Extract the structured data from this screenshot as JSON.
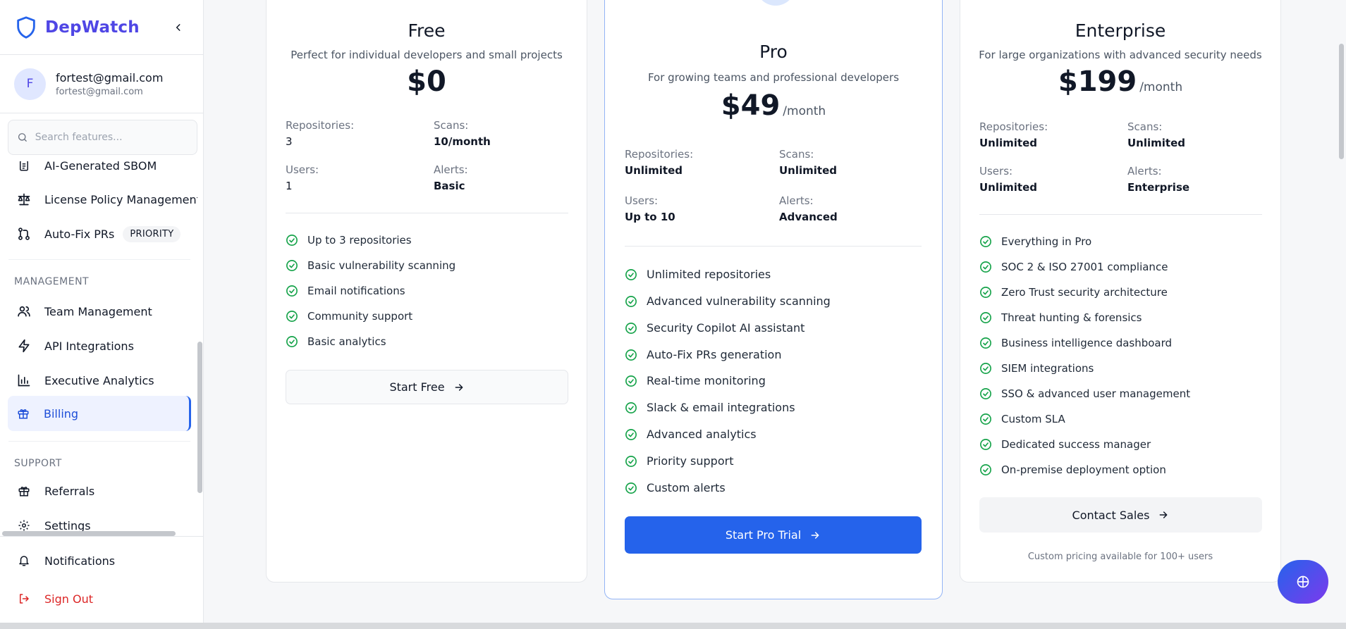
{
  "app": {
    "name": "DepWatch"
  },
  "user": {
    "initial": "F",
    "name": "fortest@gmail.com",
    "email": "fortest@gmail.com"
  },
  "search": {
    "placeholder": "Search features..."
  },
  "nav": {
    "partial_item": "AI-Generated SBOM",
    "items_top": [
      {
        "label": "License Policy Management",
        "icon": "scale-icon"
      },
      {
        "label": "Auto-Fix PRs",
        "icon": "git-pull-request-icon",
        "badge": "PRIORITY"
      }
    ],
    "management_label": "MANAGEMENT",
    "management": [
      {
        "label": "Team Management",
        "icon": "users-icon"
      },
      {
        "label": "API Integrations",
        "icon": "zap-icon"
      },
      {
        "label": "Executive Analytics",
        "icon": "bar-chart-icon"
      },
      {
        "label": "Billing",
        "icon": "gift-icon",
        "active": true
      }
    ],
    "support_label": "SUPPORT",
    "support": [
      {
        "label": "Referrals",
        "icon": "gift-icon"
      },
      {
        "label": "Settings",
        "icon": "gear-icon"
      }
    ],
    "bottom": [
      {
        "label": "Notifications",
        "icon": "bell-icon"
      },
      {
        "label": "Sign Out",
        "icon": "log-out-icon"
      }
    ]
  },
  "plans": {
    "free": {
      "name": "Free",
      "desc": "Perfect for individual developers and small projects",
      "price": "$0",
      "stats": [
        {
          "k": "Repositories:",
          "v": "3"
        },
        {
          "k": "Scans:",
          "v": "10/month"
        },
        {
          "k": "Users:",
          "v": "1"
        },
        {
          "k": "Alerts:",
          "v": "Basic"
        }
      ],
      "features": [
        "Up to 3 repositories",
        "Basic vulnerability scanning",
        "Email notifications",
        "Community support",
        "Basic analytics"
      ],
      "cta": "Start Free"
    },
    "pro": {
      "name": "Pro",
      "desc": "For growing teams and professional developers",
      "price": "$49",
      "period": "/month",
      "stats": [
        {
          "k": "Repositories:",
          "v": "Unlimited"
        },
        {
          "k": "Scans:",
          "v": "Unlimited"
        },
        {
          "k": "Users:",
          "v": "Up to 10"
        },
        {
          "k": "Alerts:",
          "v": "Advanced"
        }
      ],
      "features": [
        "Unlimited repositories",
        "Advanced vulnerability scanning",
        "Security Copilot AI assistant",
        "Auto-Fix PRs generation",
        "Real-time monitoring",
        "Slack & email integrations",
        "Advanced analytics",
        "Priority support",
        "Custom alerts"
      ],
      "cta": "Start Pro Trial"
    },
    "enterprise": {
      "name": "Enterprise",
      "desc": "For large organizations with advanced security needs",
      "price": "$199",
      "period": "/month",
      "stats": [
        {
          "k": "Repositories:",
          "v": "Unlimited"
        },
        {
          "k": "Scans:",
          "v": "Unlimited"
        },
        {
          "k": "Users:",
          "v": "Unlimited"
        },
        {
          "k": "Alerts:",
          "v": "Enterprise"
        }
      ],
      "features": [
        "Everything in Pro",
        "SOC 2 & ISO 27001 compliance",
        "Zero Trust security architecture",
        "Threat hunting & forensics",
        "Business intelligence dashboard",
        "SIEM integrations",
        "SSO & advanced user management",
        "Custom SLA",
        "Dedicated success manager",
        "On-premise deployment option"
      ],
      "cta": "Contact Sales",
      "note": "Custom pricing available for 100+ users"
    }
  },
  "colors": {
    "brand": "#4f46e5",
    "primary": "#2563eb",
    "success": "#16a34a",
    "danger": "#dc2626"
  }
}
